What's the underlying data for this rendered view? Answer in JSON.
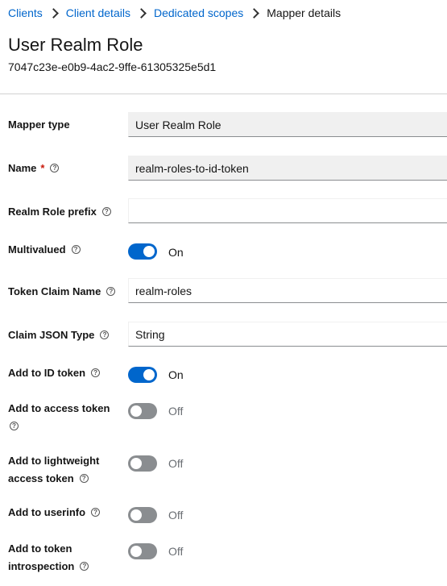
{
  "breadcrumb": {
    "items": [
      "Clients",
      "Client details",
      "Dedicated scopes"
    ],
    "current": "Mapper details"
  },
  "header": {
    "title": "User Realm Role",
    "id": "7047c23e-e0b9-4ac2-9ffe-61305325e5d1"
  },
  "form": {
    "mapper_type": {
      "label": "Mapper type",
      "value": "User Realm Role"
    },
    "name": {
      "label": "Name",
      "required_mark": "*",
      "value": "realm-roles-to-id-token"
    },
    "realm_role_prefix": {
      "label": "Realm Role prefix",
      "value": ""
    },
    "multivalued": {
      "label": "Multivalued",
      "state": "On"
    },
    "token_claim_name": {
      "label": "Token Claim Name",
      "value": "realm-roles"
    },
    "claim_json_type": {
      "label": "Claim JSON Type",
      "value": "String"
    },
    "add_to_id_token": {
      "label": "Add to ID token",
      "state": "On"
    },
    "add_to_access_token": {
      "label": "Add to access token",
      "state": "Off"
    },
    "add_to_lightweight_access_token": {
      "label_line1": "Add to lightweight",
      "label_line2": "access token",
      "state": "Off"
    },
    "add_to_userinfo": {
      "label": "Add to userinfo",
      "state": "Off"
    },
    "add_to_token_introspection": {
      "label_line1": "Add to token",
      "label_line2": "introspection",
      "state": "Off"
    }
  },
  "help_glyph": "?",
  "colors": {
    "link": "#0066cc",
    "toggle_on": "#0066cc",
    "toggle_off": "#8a8d90",
    "required": "#c9190b"
  }
}
